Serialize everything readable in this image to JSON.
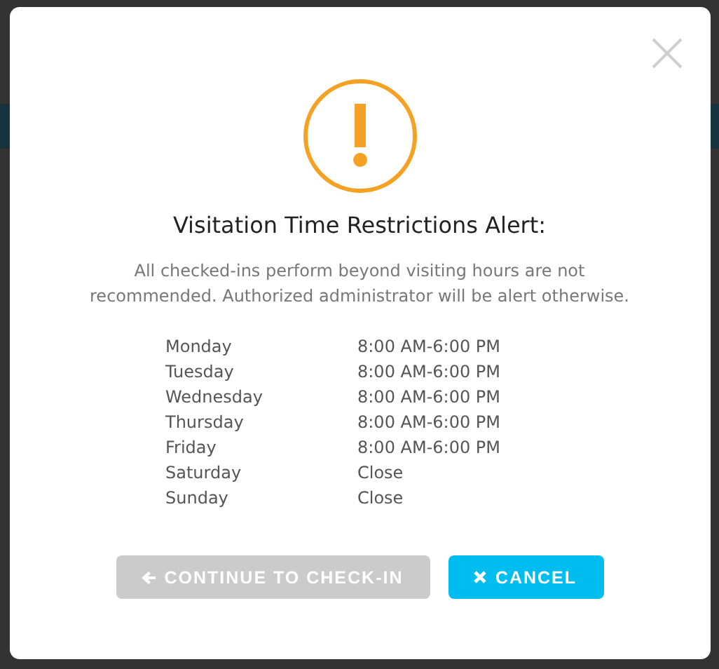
{
  "dialog": {
    "title": "Visitation Time Restrictions Alert:",
    "message": "All checked-ins perform beyond visiting hours are not recommended. Authorized administrator will be alert otherwise.",
    "schedule": [
      {
        "day": "Monday",
        "hours": "8:00 AM-6:00 PM"
      },
      {
        "day": "Tuesday",
        "hours": "8:00 AM-6:00 PM"
      },
      {
        "day": "Wednesday",
        "hours": "8:00 AM-6:00 PM"
      },
      {
        "day": "Thursday",
        "hours": "8:00 AM-6:00 PM"
      },
      {
        "day": "Friday",
        "hours": "8:00 AM-6:00 PM"
      },
      {
        "day": "Saturday",
        "hours": "Close"
      },
      {
        "day": "Sunday",
        "hours": "Close"
      }
    ],
    "buttons": [
      {
        "label": "CONTINUE TO CHECK-IN",
        "kind": "continue",
        "disabled": true
      },
      {
        "label": "CANCEL",
        "kind": "cancel",
        "disabled": false
      }
    ]
  }
}
